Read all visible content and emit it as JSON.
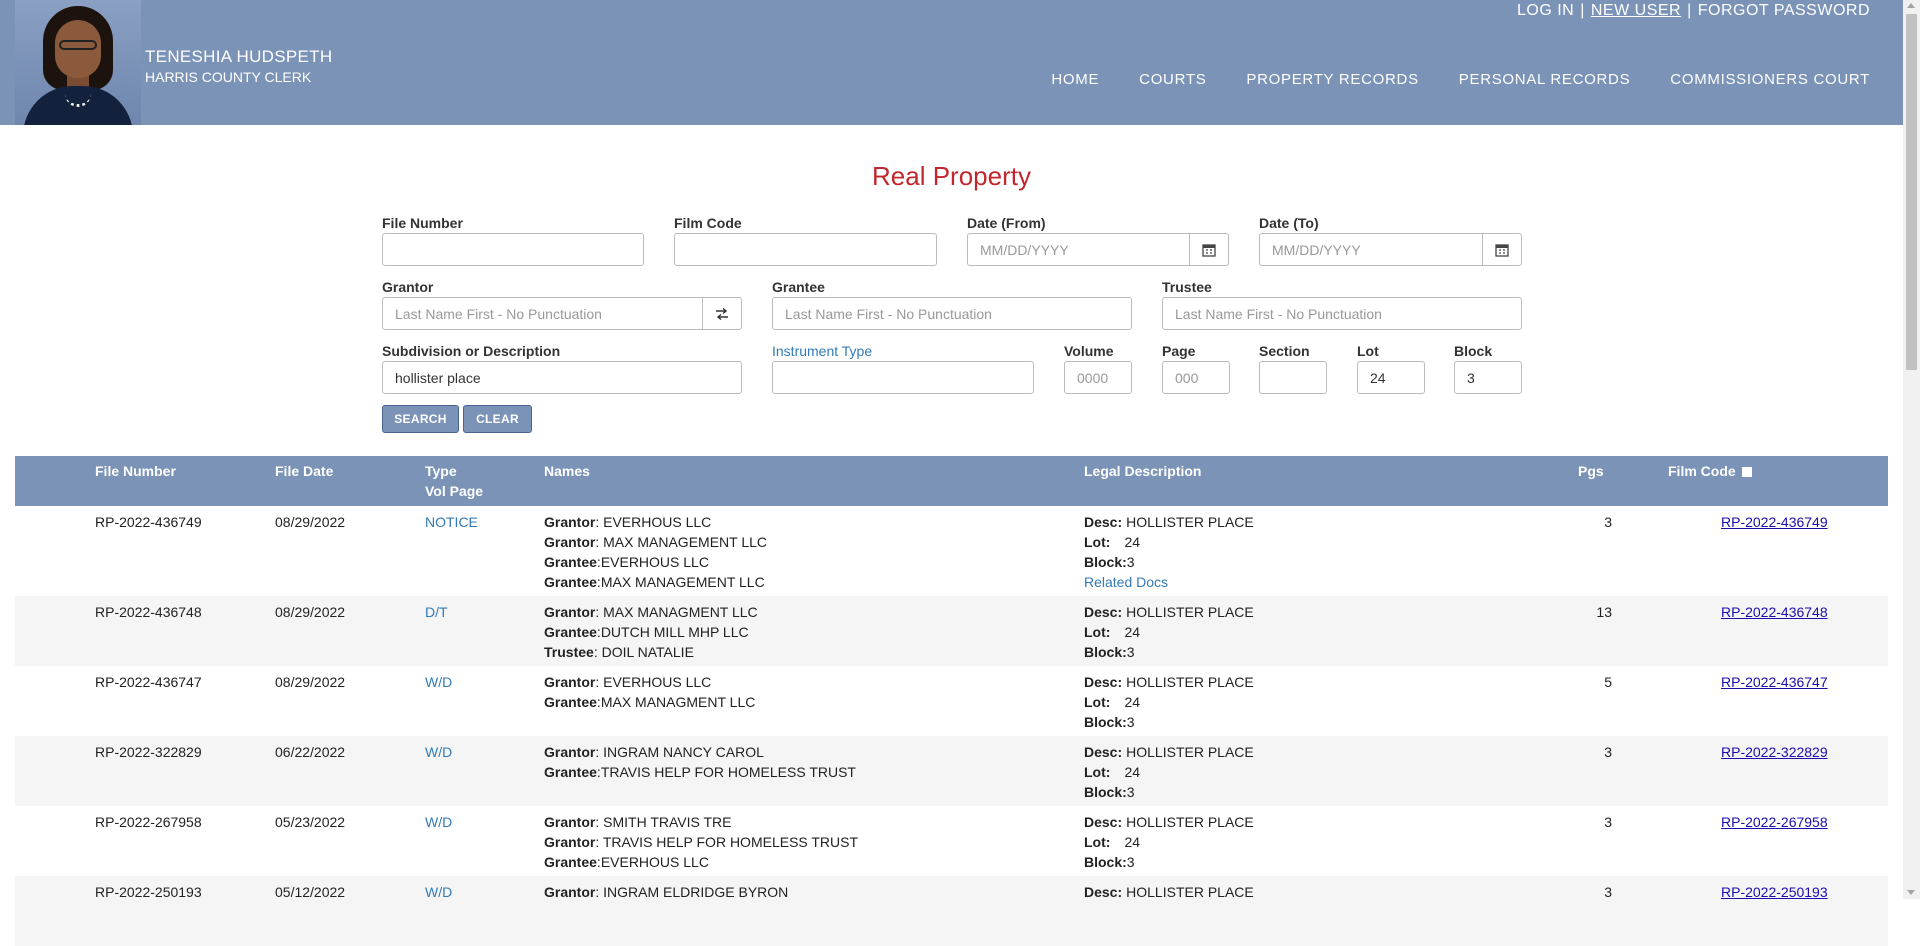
{
  "header": {
    "name": "TENESHIA HUDSPETH",
    "title": "HARRIS COUNTY CLERK",
    "login": "LOG IN",
    "new_user": "NEW USER",
    "forgot": "FORGOT PASSWORD",
    "sep": "|",
    "nav": [
      "HOME",
      "COURTS",
      "PROPERTY RECORDS",
      "PERSONAL RECORDS",
      "COMMISSIONERS COURT"
    ]
  },
  "page": {
    "title": "Real Property"
  },
  "form": {
    "file_number": {
      "label": "File Number",
      "value": ""
    },
    "film_code": {
      "label": "Film Code",
      "value": ""
    },
    "date_from": {
      "label": "Date (From)",
      "placeholder": "MM/DD/YYYY"
    },
    "date_to": {
      "label": "Date (To)",
      "placeholder": "MM/DD/YYYY"
    },
    "grantor": {
      "label": "Grantor",
      "placeholder": "Last Name First - No Punctuation"
    },
    "grantee": {
      "label": "Grantee",
      "placeholder": "Last Name First - No Punctuation"
    },
    "trustee": {
      "label": "Trustee",
      "placeholder": "Last Name First - No Punctuation"
    },
    "subdivision": {
      "label": "Subdivision or Description",
      "value": "hollister place"
    },
    "instrument_type": {
      "label": "Instrument Type",
      "value": ""
    },
    "volume": {
      "label": "Volume",
      "placeholder": "0000"
    },
    "page": {
      "label": "Page",
      "placeholder": "000"
    },
    "section": {
      "label": "Section",
      "value": ""
    },
    "lot": {
      "label": "Lot",
      "value": "24"
    },
    "block": {
      "label": "Block",
      "value": "3"
    },
    "search_label": "SEARCH",
    "clear_label": "CLEAR"
  },
  "table": {
    "headers": {
      "file_number": "File Number",
      "file_date": "File Date",
      "type": "Type",
      "vol_page": "Vol Page",
      "names": "Names",
      "legal": "Legal Description",
      "pgs": "Pgs",
      "film_code": "Film Code"
    },
    "labels": {
      "grantor": "Grantor",
      "grantee": "Grantee",
      "trustee": "Trustee",
      "desc": "Desc:",
      "lot": "Lot:",
      "block": "Block:",
      "related": "Related Docs"
    },
    "rows": [
      {
        "file_number": "RP-2022-436749",
        "file_date": "08/29/2022",
        "type": "NOTICE",
        "names": [
          {
            "role": "Grantor",
            "sep": ": ",
            "name": "EVERHOUS LLC"
          },
          {
            "role": "Grantor",
            "sep": ": ",
            "name": "MAX MANAGEMENT LLC"
          },
          {
            "role": "Grantee",
            "sep": ":",
            "name": "EVERHOUS LLC"
          },
          {
            "role": "Grantee",
            "sep": ":",
            "name": "MAX MANAGEMENT LLC"
          }
        ],
        "desc": "HOLLISTER PLACE",
        "lot": "24",
        "block": "3",
        "related": true,
        "pgs": "3",
        "film_code": "RP-2022-436749"
      },
      {
        "file_number": "RP-2022-436748",
        "file_date": "08/29/2022",
        "type": "D/T",
        "names": [
          {
            "role": "Grantor",
            "sep": ": ",
            "name": "MAX MANAGMENT LLC"
          },
          {
            "role": "Grantee",
            "sep": ":",
            "name": "DUTCH MILL MHP LLC"
          },
          {
            "role": "Trustee",
            "sep": ": ",
            "name": "DOIL NATALIE"
          }
        ],
        "desc": "HOLLISTER PLACE",
        "lot": "24",
        "block": "3",
        "related": false,
        "pgs": "13",
        "film_code": "RP-2022-436748"
      },
      {
        "file_number": "RP-2022-436747",
        "file_date": "08/29/2022",
        "type": "W/D",
        "names": [
          {
            "role": "Grantor",
            "sep": ": ",
            "name": "EVERHOUS LLC"
          },
          {
            "role": "Grantee",
            "sep": ":",
            "name": "MAX MANAGMENT LLC"
          }
        ],
        "desc": "HOLLISTER PLACE",
        "lot": "24",
        "block": "3",
        "related": false,
        "pgs": "5",
        "film_code": "RP-2022-436747"
      },
      {
        "file_number": "RP-2022-322829",
        "file_date": "06/22/2022",
        "type": "W/D",
        "names": [
          {
            "role": "Grantor",
            "sep": ": ",
            "name": "INGRAM NANCY CAROL"
          },
          {
            "role": "Grantee",
            "sep": ":",
            "name": "TRAVIS HELP FOR HOMELESS TRUST"
          }
        ],
        "desc": "HOLLISTER PLACE",
        "lot": "24",
        "block": "3",
        "related": false,
        "pgs": "3",
        "film_code": "RP-2022-322829"
      },
      {
        "file_number": "RP-2022-267958",
        "file_date": "05/23/2022",
        "type": "W/D",
        "names": [
          {
            "role": "Grantor",
            "sep": ": ",
            "name": "SMITH TRAVIS TRE"
          },
          {
            "role": "Grantor",
            "sep": ": ",
            "name": "TRAVIS HELP FOR HOMELESS TRUST"
          },
          {
            "role": "Grantee",
            "sep": ":",
            "name": "EVERHOUS LLC"
          }
        ],
        "desc": "HOLLISTER PLACE",
        "lot": "24",
        "block": "3",
        "related": false,
        "pgs": "3",
        "film_code": "RP-2022-267958"
      },
      {
        "file_number": "RP-2022-250193",
        "file_date": "05/12/2022",
        "type": "W/D",
        "names": [
          {
            "role": "Grantor",
            "sep": ": ",
            "name": "INGRAM ELDRIDGE BYRON"
          }
        ],
        "desc": "HOLLISTER PLACE",
        "lot": "",
        "block": "",
        "related": false,
        "pgs": "3",
        "film_code": "RP-2022-250193"
      }
    ]
  }
}
